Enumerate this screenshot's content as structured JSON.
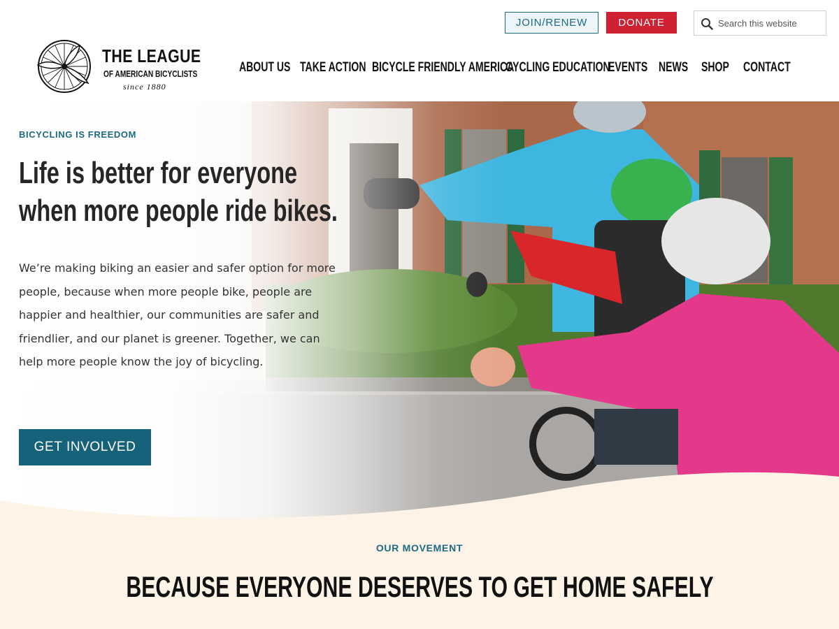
{
  "logo": {
    "title": "THE LEAGUE",
    "subtitle": "OF AMERICAN BICYCLISTS",
    "since": "since 1880"
  },
  "utility": {
    "join_label": "JOIN/RENEW",
    "donate_label": "DONATE",
    "search_placeholder": "Search this website",
    "search_value": "",
    "search_icon": "search-icon"
  },
  "nav": {
    "items": [
      {
        "label": "ABOUT US"
      },
      {
        "label": "TAKE ACTION"
      },
      {
        "label": "BICYCLE FRIENDLY AMERICA"
      },
      {
        "label": "CYCLING EDUCATION"
      },
      {
        "label": "EVENTS"
      },
      {
        "label": "NEWS"
      },
      {
        "label": "SHOP"
      },
      {
        "label": "CONTACT"
      }
    ]
  },
  "hero": {
    "eyebrow": "BICYCLING IS FREEDOM",
    "title": "Life is better for everyone when more people ride bikes.",
    "body": "We’re making biking an easier and safer option for more people, because when more people bike, people are happier and healthier, our communities are safer and friendlier, and our planet is greener. Together, we can help more people know the joy of bicycling.",
    "cta_label": "GET INVOLVED"
  },
  "movement": {
    "eyebrow": "OUR MOVEMENT",
    "title": "BECAUSE EVERYONE DESERVES TO GET HOME SAFELY"
  },
  "colors": {
    "brand_teal": "#1b6a84",
    "cta_teal": "#15627a",
    "donate_red": "#cf2131",
    "section_cream": "#fdf4e7"
  }
}
